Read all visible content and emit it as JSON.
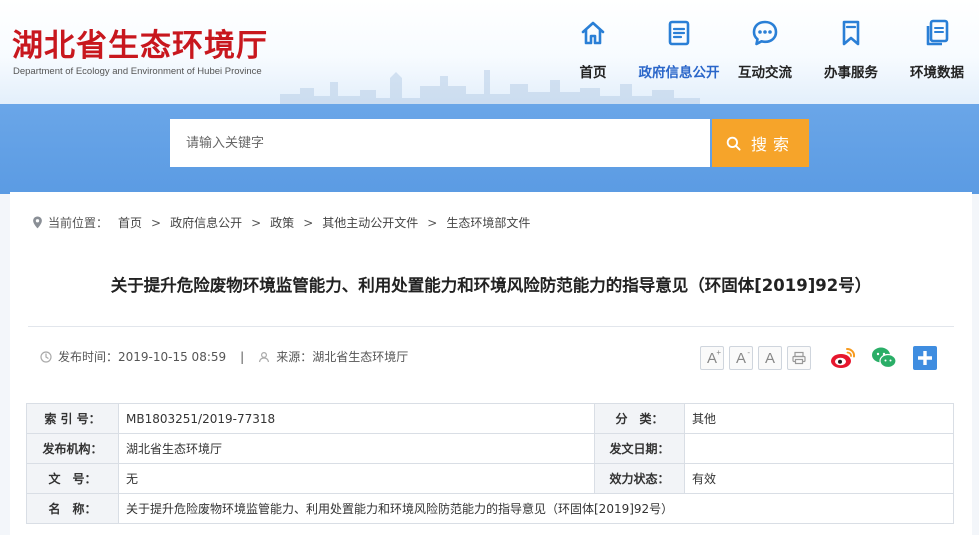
{
  "header": {
    "logo_cn": "湖北省生态环境厅",
    "logo_en": "Department of Ecology and Environment of Hubei Province",
    "nav": [
      {
        "label": "首页",
        "icon": "home-icon"
      },
      {
        "label": "政府信息公开",
        "icon": "document-icon",
        "active": true
      },
      {
        "label": "互动交流",
        "icon": "chat-icon"
      },
      {
        "label": "办事服务",
        "icon": "bookmark-icon"
      },
      {
        "label": "环境数据",
        "icon": "data-copy-icon"
      }
    ]
  },
  "search": {
    "placeholder": "请输入关键字",
    "button_label": "搜索"
  },
  "breadcrumb": {
    "prefix": "当前位置：",
    "items": [
      "首页",
      "政府信息公开",
      "政策",
      "其他主动公开文件",
      "生态环境部文件"
    ],
    "separator": ">"
  },
  "article": {
    "title": "关于提升危险废物环境监管能力、利用处置能力和环境风险防范能力的指导意见（环固体[2019]92号）",
    "publish_time": "发布时间：2019-10-15 08:59",
    "source": "来源：湖北省生态环境厅"
  },
  "tools": {
    "font_buttons": [
      "A",
      "A",
      "A"
    ],
    "font_superscripts": [
      "+",
      "-",
      ""
    ],
    "print_icon": "print-icon",
    "share_icons": [
      "weibo-icon",
      "wechat-icon",
      "plus-share-icon"
    ]
  },
  "info_table": {
    "index_label": "索 引 号：",
    "index_value": "MB1803251/2019-77318",
    "category_label": "分　类：",
    "category_value": "其他",
    "publisher_label": "发布机构：",
    "publisher_value": "湖北省生态环境厅",
    "doc_date_label": "发文日期：",
    "doc_date_value": "",
    "doc_no_label": "文　号：",
    "doc_no_value": "无",
    "status_label": "效力状态：",
    "status_value": "有效",
    "name_label": "名　称：",
    "name_value": "关于提升危险废物环境监管能力、利用处置能力和环境风险防范能力的指导意见（环固体[2019]92号）"
  },
  "colors": {
    "brand_red": "#c8171e",
    "nav_blue": "#2a66c9",
    "banner_blue": "#5b9be3",
    "search_orange": "#f6a42a"
  }
}
